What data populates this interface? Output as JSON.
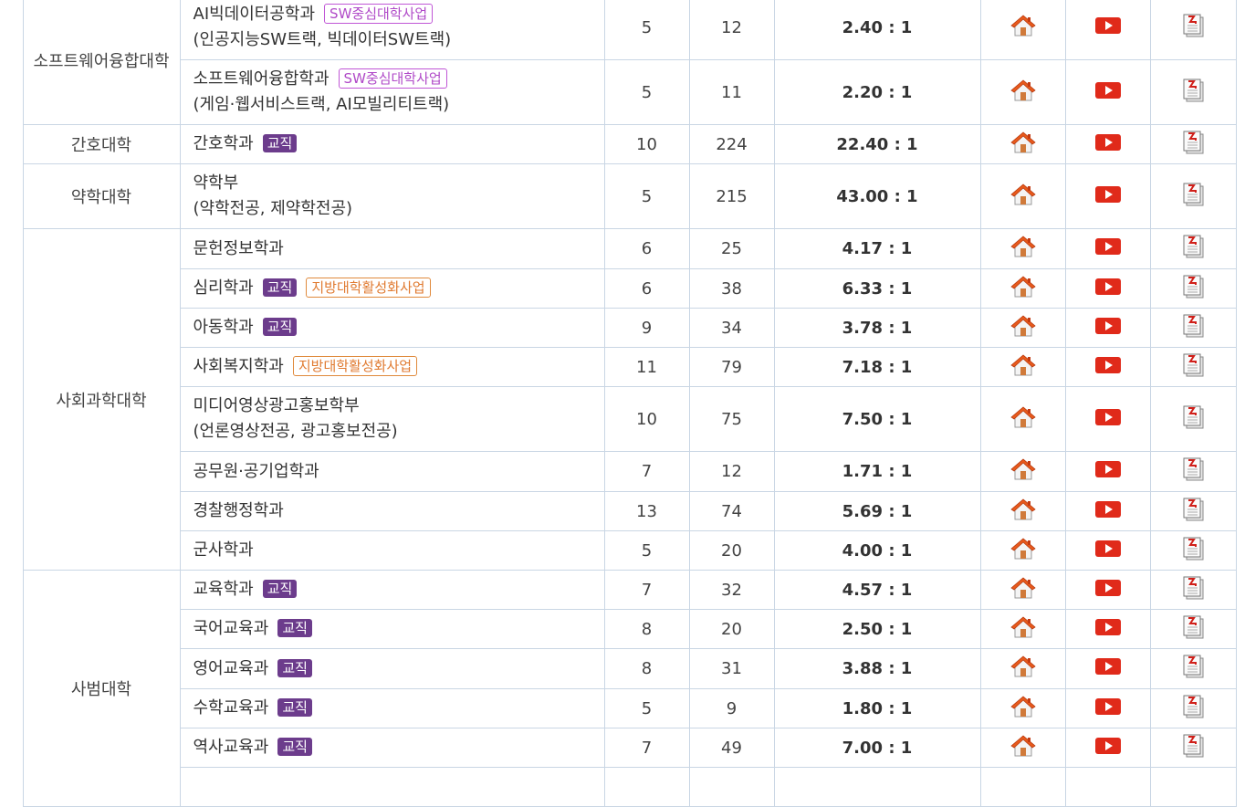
{
  "rows": [
    {
      "college": "소프트웨어융합대학",
      "rowspan": 2,
      "dept": "AI빅데이터공학과",
      "badges": [
        {
          "type": "sw",
          "label": "SW중심대학사업"
        }
      ],
      "sub": "(인공지능SW트랙, 빅데이터SW트랙)",
      "quota": "5",
      "applicants": "12",
      "ratio": "2.40 : 1",
      "h": 71
    },
    {
      "dept": "소프트웨어융합학과",
      "badges": [
        {
          "type": "sw",
          "label": "SW중심대학사업"
        }
      ],
      "sub": "(게임·웹서비스트랙, AI모빌리티트랙)",
      "quota": "5",
      "applicants": "11",
      "ratio": "2.20 : 1",
      "h": 71
    },
    {
      "college": "간호대학",
      "rowspan": 1,
      "dept": "간호학과",
      "badges": [
        {
          "type": "edu",
          "label": "교직"
        }
      ],
      "quota": "10",
      "applicants": "224",
      "ratio": "22.40 : 1",
      "h": 43
    },
    {
      "college": "약학대학",
      "rowspan": 1,
      "dept": "약학부",
      "badges": [],
      "sub": "(약학전공, 제약학전공)",
      "quota": "5",
      "applicants": "215",
      "ratio": "43.00 : 1",
      "h": 71
    },
    {
      "college": "사회과학대학",
      "rowspan": 8,
      "dept": "문헌정보학과",
      "badges": [],
      "quota": "6",
      "applicants": "25",
      "ratio": "4.17 : 1",
      "h": 44
    },
    {
      "dept": "심리학과",
      "badges": [
        {
          "type": "edu",
          "label": "교직"
        },
        {
          "type": "loc",
          "label": "지방대학활성화사업"
        }
      ],
      "quota": "6",
      "applicants": "38",
      "ratio": "6.33 : 1",
      "h": 43
    },
    {
      "dept": "아동학과",
      "badges": [
        {
          "type": "edu",
          "label": "교직"
        }
      ],
      "quota": "9",
      "applicants": "34",
      "ratio": "3.78 : 1",
      "h": 43
    },
    {
      "dept": "사회복지학과",
      "badges": [
        {
          "type": "loc",
          "label": "지방대학활성화사업"
        }
      ],
      "quota": "11",
      "applicants": "79",
      "ratio": "7.18 : 1",
      "h": 43
    },
    {
      "dept": "미디어영상광고홍보학부",
      "badges": [],
      "sub": "(언론영상전공, 광고홍보전공)",
      "quota": "10",
      "applicants": "75",
      "ratio": "7.50 : 1",
      "h": 71
    },
    {
      "dept": "공무원·공기업학과",
      "badges": [],
      "quota": "7",
      "applicants": "12",
      "ratio": "1.71 : 1",
      "h": 44
    },
    {
      "dept": "경찰행정학과",
      "badges": [],
      "quota": "13",
      "applicants": "74",
      "ratio": "5.69 : 1",
      "h": 43
    },
    {
      "dept": "군사학과",
      "badges": [],
      "quota": "5",
      "applicants": "20",
      "ratio": "4.00 : 1",
      "h": 43
    },
    {
      "college": "사범대학",
      "rowspan": 6,
      "dept": "교육학과",
      "badges": [
        {
          "type": "edu",
          "label": "교직"
        }
      ],
      "quota": "7",
      "applicants": "32",
      "ratio": "4.57 : 1",
      "h": 43
    },
    {
      "dept": "국어교육과",
      "badges": [
        {
          "type": "edu",
          "label": "교직"
        }
      ],
      "quota": "8",
      "applicants": "20",
      "ratio": "2.50 : 1",
      "h": 43
    },
    {
      "dept": "영어교육과",
      "badges": [
        {
          "type": "edu",
          "label": "교직"
        }
      ],
      "quota": "8",
      "applicants": "31",
      "ratio": "3.88 : 1",
      "h": 44
    },
    {
      "dept": "수학교육과",
      "badges": [
        {
          "type": "edu",
          "label": "교직"
        }
      ],
      "quota": "5",
      "applicants": "9",
      "ratio": "1.80 : 1",
      "h": 43
    },
    {
      "dept": "역사교육과",
      "badges": [
        {
          "type": "edu",
          "label": "교직"
        }
      ],
      "quota": "7",
      "applicants": "49",
      "ratio": "7.00 : 1",
      "h": 43
    },
    {
      "dept": "",
      "badges": [],
      "quota": "",
      "applicants": "",
      "ratio": "",
      "h": 43,
      "hideIcons": true
    }
  ],
  "icons": {
    "home": "home-icon",
    "video": "video-play-icon",
    "doc": "pdf-document-icon"
  },
  "colors": {
    "edu": "#6c3c8c",
    "sw": "#b04ac8",
    "loc": "#e07a30",
    "border": "#c9d6e4",
    "video": "#e02a1a",
    "home": "#e85a1c"
  }
}
